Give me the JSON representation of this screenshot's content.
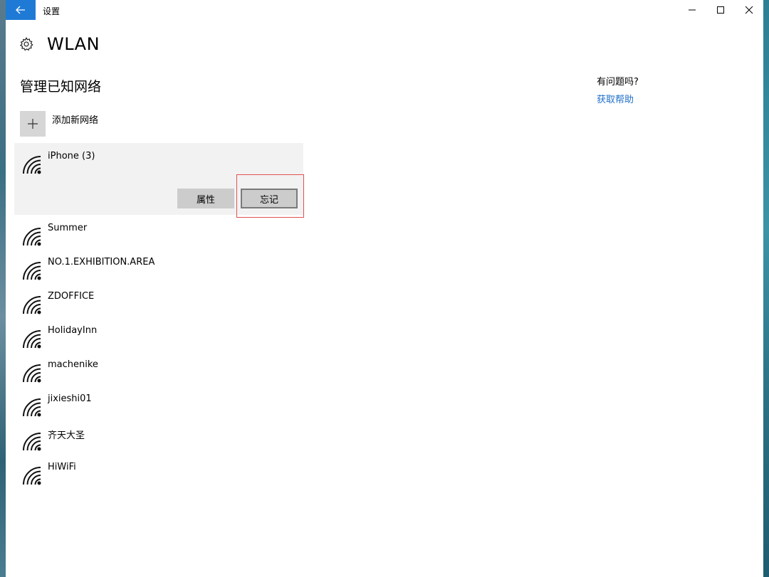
{
  "window": {
    "title": "设置"
  },
  "header": {
    "title": "WLAN"
  },
  "section": {
    "title": "管理已知网络",
    "add_label": "添加新网络"
  },
  "selected_network": {
    "name": "iPhone (3)",
    "properties_label": "属性",
    "forget_label": "忘记"
  },
  "networks": [
    {
      "name": "Summer"
    },
    {
      "name": "NO.1.EXHIBITION.AREA"
    },
    {
      "name": "ZDOFFICE"
    },
    {
      "name": "HolidayInn"
    },
    {
      "name": "machenike"
    },
    {
      "name": "jixieshi01"
    },
    {
      "name": "齐天大圣"
    },
    {
      "name": "HiWiFi"
    }
  ],
  "help": {
    "title": "有问题吗?",
    "link": "获取帮助"
  },
  "colors": {
    "accent": "#1f7ad6",
    "link": "#1f6fc9",
    "highlight": "#e05050"
  }
}
